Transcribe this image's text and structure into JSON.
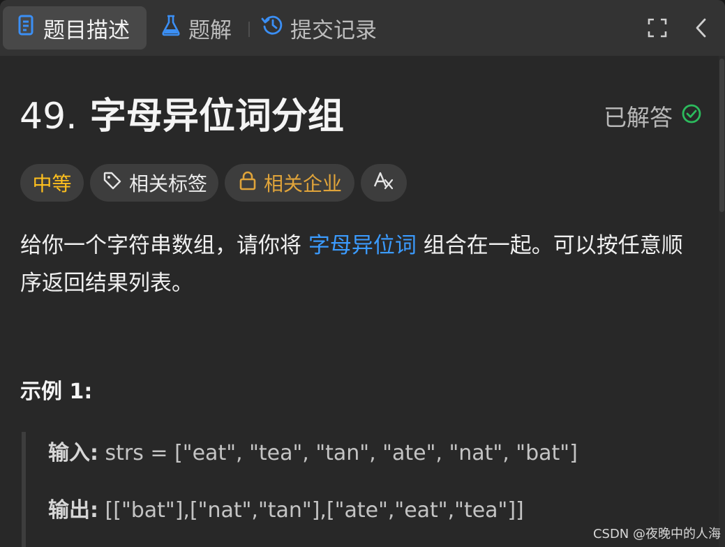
{
  "tabs": {
    "description": {
      "label": "题目描述",
      "icon": "document-icon"
    },
    "solution": {
      "label": "题解",
      "icon": "flask-icon"
    },
    "submissions": {
      "label": "提交记录",
      "icon": "history-icon"
    }
  },
  "toolbar": {
    "expand_icon": "fullscreen-icon",
    "collapse_icon": "chevron-left-icon"
  },
  "problem": {
    "number": "49.",
    "title": "字母异位词分组",
    "status": "已解答",
    "status_icon": "check-circle-icon",
    "status_color": "#2cbb5d"
  },
  "chips": {
    "difficulty": "中等",
    "difficulty_color": "#ffc01e",
    "tags": "相关标签",
    "company": "相关企业",
    "company_color": "#e0a43a",
    "translate_icon": "translate-icon"
  },
  "description": {
    "part1": "给你一个字符串数组，请你将 ",
    "link": "字母异位词",
    "part2": " 组合在一起。可以按任意顺序返回结果列表。",
    "link_color": "#3b9bff"
  },
  "example": {
    "heading": "示例 1:",
    "input_label": "输入:",
    "input_value": " strs = [\"eat\", \"tea\", \"tan\", \"ate\", \"nat\", \"bat\"]",
    "output_label": "输出:",
    "output_value": " [[\"bat\"],[\"nat\",\"tan\"],[\"ate\",\"eat\",\"tea\"]]"
  },
  "watermark": "CSDN @夜晚中的人海"
}
